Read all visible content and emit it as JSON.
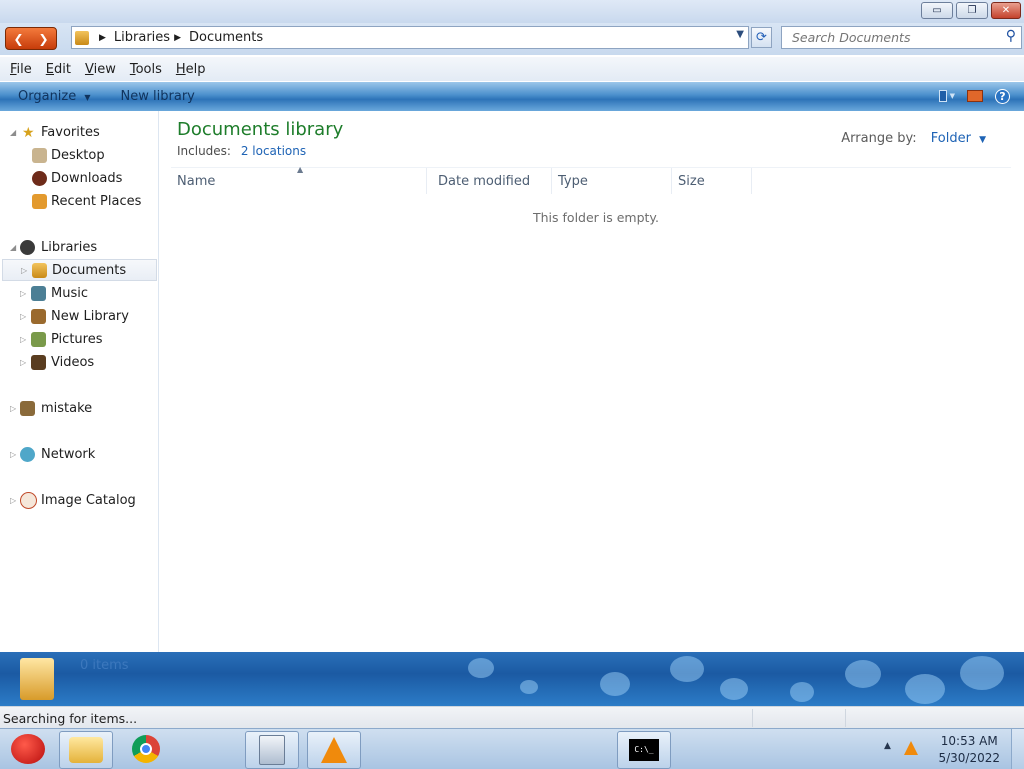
{
  "window": {
    "controls": {
      "minimize": "▭",
      "restore": "❐",
      "close": "✕"
    }
  },
  "address": {
    "segments": [
      "Libraries",
      "Documents"
    ],
    "search_placeholder": "Search Documents"
  },
  "menu": [
    "File",
    "Edit",
    "View",
    "Tools",
    "Help"
  ],
  "commands": {
    "organize": "Organize",
    "new_library": "New library"
  },
  "nav": {
    "favorites": {
      "label": "Favorites",
      "items": [
        "Desktop",
        "Downloads",
        "Recent Places"
      ]
    },
    "libraries": {
      "label": "Libraries",
      "items": [
        "Documents",
        "Music",
        "New Library",
        "Pictures",
        "Videos"
      ],
      "selected": "Documents"
    },
    "others": [
      "mistake",
      "Network",
      "Image Catalog"
    ]
  },
  "content": {
    "title": "Documents library",
    "includes_label": "Includes:",
    "includes_link": "2 locations",
    "arrange_label": "Arrange by:",
    "arrange_value": "Folder",
    "columns": [
      "Name",
      "Date modified",
      "Type",
      "Size"
    ],
    "empty_message": "This folder is empty."
  },
  "details": {
    "count": "0 items"
  },
  "status": {
    "text": "Searching for items..."
  },
  "taskbar": {
    "time": "10:53 AM",
    "date": "5/30/2022",
    "apps": [
      "start-button",
      "file-explorer",
      "chrome",
      "calculator",
      "vlc",
      "command-prompt"
    ]
  },
  "colors": {
    "library_title": "#1e7d2b",
    "link": "#1e63b5",
    "command_bar": "#4a8fcc"
  }
}
